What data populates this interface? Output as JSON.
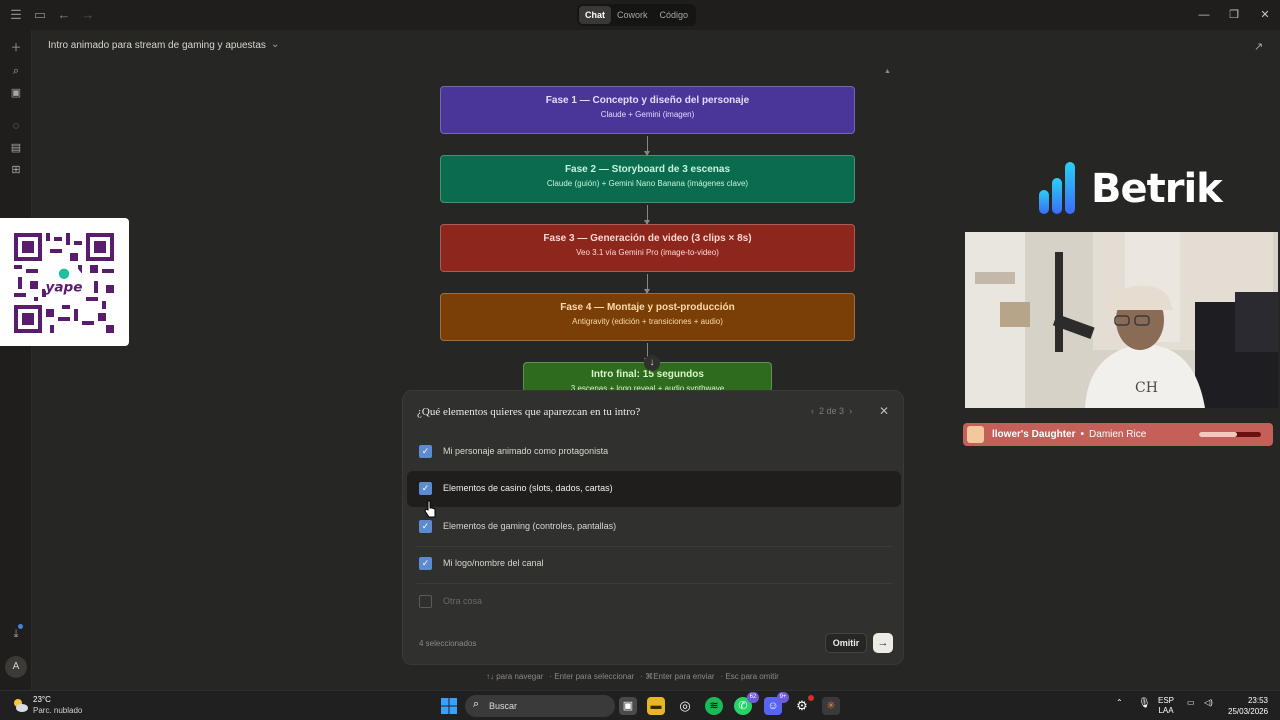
{
  "titlebar": {
    "tabs": [
      {
        "label": "Chat",
        "active": true
      },
      {
        "label": "Cowork",
        "active": false
      },
      {
        "label": "Código",
        "active": false
      }
    ]
  },
  "conversation": {
    "title": "Intro animado para stream de gaming y apuestas"
  },
  "flow": {
    "phases": [
      {
        "title": "Fase 1 — Concepto y diseño del personaje",
        "subtitle": "Claude + Gemini (imagen)"
      },
      {
        "title": "Fase 2 — Storyboard de 3 escenas",
        "subtitle": "Claude (guión) + Gemini Nano Banana (imágenes clave)"
      },
      {
        "title": "Fase 3 — Generación de video (3 clips × 8s)",
        "subtitle": "Veo 3.1 vía Gemini Pro (image-to-video)"
      },
      {
        "title": "Fase 4 — Montaje y post-producción",
        "subtitle": "Antigravity (edición + transiciones + audio)"
      }
    ],
    "final": {
      "title": "Intro final: 15 segundos",
      "subtitle": "3 escenas + logo reveal + audio synthwave"
    }
  },
  "question": {
    "title": "¿Qué elementos quieres que aparezcan en tu intro?",
    "pager": "2 de 3",
    "options": [
      {
        "label": "Mi personaje animado como protagonista",
        "checked": true
      },
      {
        "label": "Elementos de casino (slots, dados, cartas)",
        "checked": true
      },
      {
        "label": "Elementos de gaming (controles, pantallas)",
        "checked": true
      },
      {
        "label": "Mi logo/nombre del canal",
        "checked": true
      },
      {
        "label": "Otra cosa",
        "checked": false
      }
    ],
    "count": "4 seleccionados",
    "skip_label": "Omitir",
    "hints": [
      "↑↓ para navegar",
      "Enter para seleccionar",
      "⌘Enter para enviar",
      "Esc para omitir"
    ]
  },
  "overlay": {
    "qr_text": "yape",
    "brand": "Betrik",
    "now_playing": {
      "title": "llower's Daughter",
      "artist": "Damien Rice",
      "progress": 0.62
    }
  },
  "taskbar": {
    "temp": "23°C",
    "weather": "Parc. nublado",
    "search": "Buscar",
    "whatsapp_badge": "62",
    "discord_badge": "9+",
    "lang": "ESP",
    "region": "LAA",
    "time": "23:53",
    "date": "25/03/2026"
  },
  "colors": {
    "accent_checkbox": "#5d8bd0",
    "background": "#262624"
  }
}
